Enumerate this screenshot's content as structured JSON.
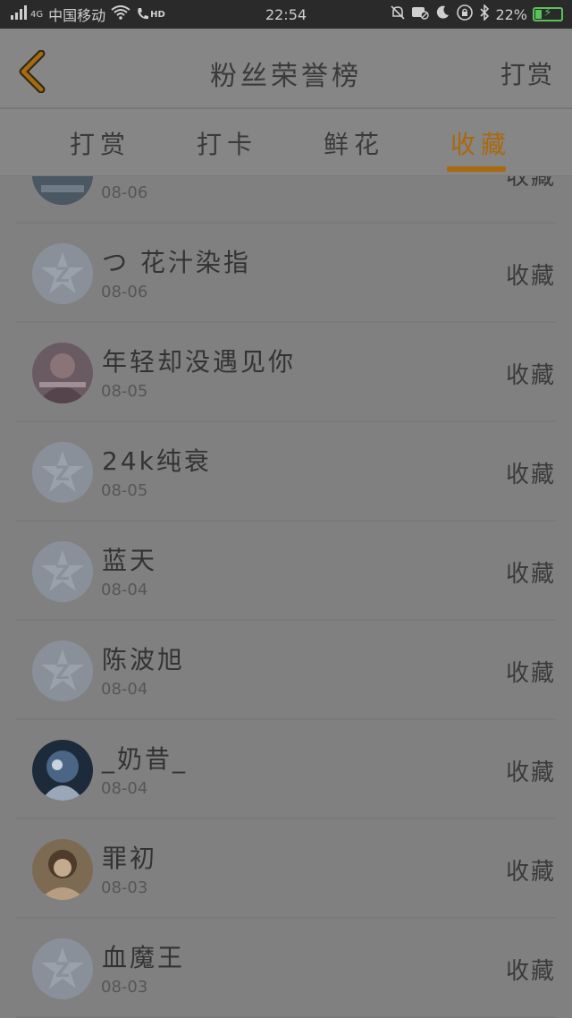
{
  "status_bar": {
    "network": "4G",
    "carrier": "中国移动",
    "hd": "HD",
    "time": "22:54",
    "battery": "22%",
    "icons": [
      "signal-icon",
      "wifi-icon",
      "call-hd-icon",
      "mute-icon",
      "dnd-icon",
      "moon-icon",
      "lock-rotation-icon",
      "bluetooth-icon",
      "battery-charging-icon"
    ]
  },
  "header": {
    "title": "粉丝荣誉榜",
    "action": "打赏",
    "back_icon": "chevron-left-icon",
    "accent": "#a9690f"
  },
  "tabs": [
    {
      "label": "打赏",
      "active": false
    },
    {
      "label": "打卡",
      "active": false
    },
    {
      "label": "鲜花",
      "active": false
    },
    {
      "label": "收藏",
      "active": true
    }
  ],
  "list": [
    {
      "name": "",
      "date": "08-06",
      "action": "收藏",
      "avatar": "photo"
    },
    {
      "name": "つ 花汁染指",
      "date": "08-06",
      "action": "收藏",
      "avatar": "default"
    },
    {
      "name": "年轻却没遇见你",
      "date": "08-05",
      "action": "收藏",
      "avatar": "photo"
    },
    {
      "name": "24k纯衰",
      "date": "08-05",
      "action": "收藏",
      "avatar": "default"
    },
    {
      "name": "蓝天",
      "date": "08-04",
      "action": "收藏",
      "avatar": "default"
    },
    {
      "name": "陈波旭",
      "date": "08-04",
      "action": "收藏",
      "avatar": "default"
    },
    {
      "name": "_奶昔_",
      "date": "08-04",
      "action": "收藏",
      "avatar": "photo"
    },
    {
      "name": "罪初",
      "date": "08-03",
      "action": "收藏",
      "avatar": "photo"
    },
    {
      "name": "血魔王",
      "date": "08-03",
      "action": "收藏",
      "avatar": "default"
    }
  ]
}
